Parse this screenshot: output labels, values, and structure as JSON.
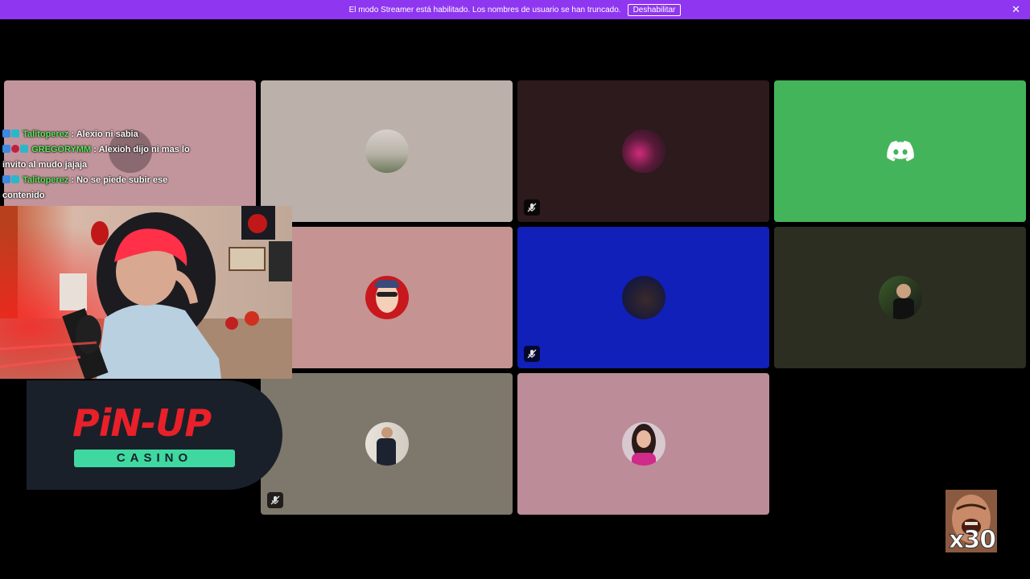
{
  "banner": {
    "message": "El modo Streamer está habilitado. Los nombres de usuario se han truncado.",
    "button_label": "Deshabilitar",
    "close": "✕",
    "color": "#8f36f0"
  },
  "tiles": [
    {
      "color": "#c2949c",
      "muted": false
    },
    {
      "color": "#bbb0aa",
      "muted": false
    },
    {
      "color": "#2c1a1d",
      "muted": true
    },
    {
      "color": "#44b45a",
      "muted": false,
      "icon": "discord-icon"
    },
    {
      "color": "#c49392",
      "muted": false
    },
    {
      "color": "#1020b8",
      "muted": true
    },
    {
      "color": "#2c2e22",
      "muted": false
    },
    {
      "color": "#7e776b",
      "muted": true
    },
    {
      "color": "#bc8c98",
      "muted": false
    }
  ],
  "chat": [
    {
      "user": "Talitoperez",
      "message": " : Alexio ni sabia"
    },
    {
      "user": "GREGORYMM",
      "message": " : Alexioh dijo ni mas lo invito al mudo jajaja"
    },
    {
      "user": "Talitoperez",
      "message": " : No se piede subir ese contenido"
    }
  ],
  "sponsor": {
    "title": "PiN-UP",
    "subtitle": "CASINO"
  },
  "emote": {
    "count": "x30"
  }
}
